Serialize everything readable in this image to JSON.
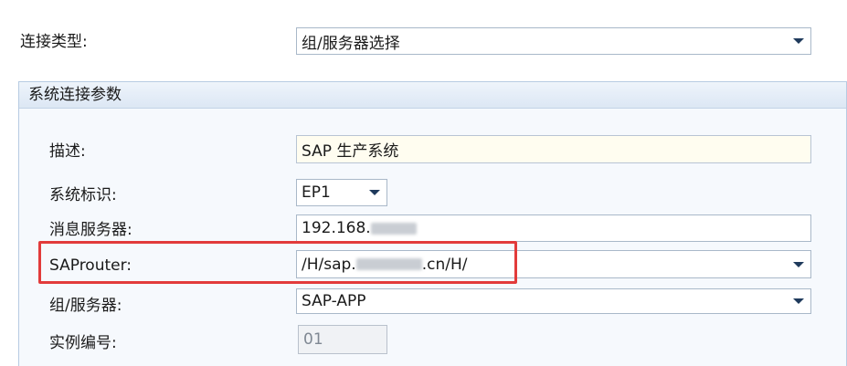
{
  "connection_type": {
    "label": "连接类型:",
    "value": "组/服务器选择"
  },
  "system_params": {
    "header": "系统连接参数",
    "description": {
      "label": "描述:",
      "value": "SAP 生产系统"
    },
    "system_id": {
      "label": "系统标识:",
      "value": "EP1"
    },
    "message_server": {
      "label": "消息服务器:",
      "value": "192.168."
    },
    "saprouter": {
      "label": "SAProuter:",
      "value_prefix": "/H/sap.",
      "value_suffix": ".cn/H/"
    },
    "group_server": {
      "label": "组/服务器:",
      "value": "SAP-APP"
    },
    "instance_number": {
      "label": "实例编号:",
      "value": "01"
    }
  },
  "colors": {
    "highlight": "#e23b3b",
    "combo_arrow": "#1f3a5c",
    "group_border": "#b7cbe2"
  }
}
